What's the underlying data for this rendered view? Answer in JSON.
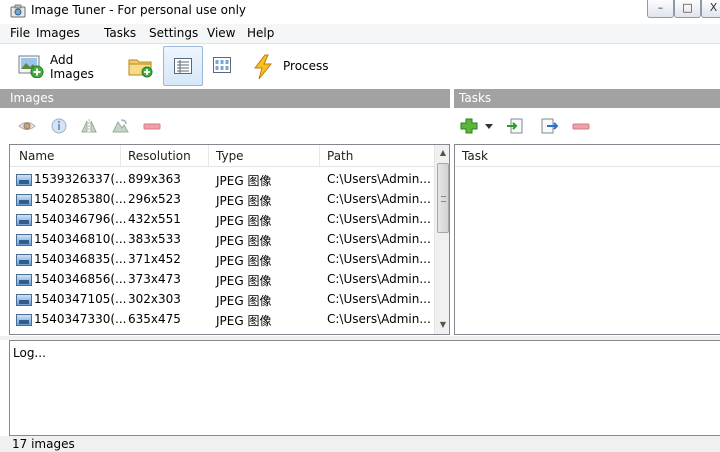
{
  "window": {
    "title": "Image Tuner - For personal use only",
    "icon": "app-camera-icon",
    "controls": {
      "minimize": "–",
      "maximize": "□",
      "close": "X"
    }
  },
  "menu": {
    "items": [
      "File",
      "Images",
      "Tasks",
      "Settings",
      "View",
      "Help"
    ]
  },
  "toolbar": {
    "add_images_line1": "Add",
    "add_images_line2": "Images",
    "add_folder_icon": "folder-add-icon",
    "details_view_icon": "details-view-icon",
    "thumbnails_view_icon": "thumbnails-view-icon",
    "process_label": "Process",
    "process_icon": "lightning-icon"
  },
  "images_panel": {
    "header": "Images",
    "tools": [
      "view-eye-icon",
      "info-icon",
      "mirror-icon",
      "rotate-icon",
      "remove-icon"
    ],
    "columns": [
      "Name",
      "Resolution",
      "Type",
      "Path"
    ],
    "rows": [
      {
        "name": "1539326337(...",
        "resolution": "899x363",
        "type": "JPEG 图像",
        "path": "C:\\Users\\Admin..."
      },
      {
        "name": "1540285380(...",
        "resolution": "296x523",
        "type": "JPEG 图像",
        "path": "C:\\Users\\Admin..."
      },
      {
        "name": "1540346796(...",
        "resolution": "432x551",
        "type": "JPEG 图像",
        "path": "C:\\Users\\Admin..."
      },
      {
        "name": "1540346810(...",
        "resolution": "383x533",
        "type": "JPEG 图像",
        "path": "C:\\Users\\Admin..."
      },
      {
        "name": "1540346835(...",
        "resolution": "371x452",
        "type": "JPEG 图像",
        "path": "C:\\Users\\Admin..."
      },
      {
        "name": "1540346856(...",
        "resolution": "373x473",
        "type": "JPEG 图像",
        "path": "C:\\Users\\Admin..."
      },
      {
        "name": "1540347105(...",
        "resolution": "302x303",
        "type": "JPEG 图像",
        "path": "C:\\Users\\Admin..."
      },
      {
        "name": "1540347330(...",
        "resolution": "635x475",
        "type": "JPEG 图像",
        "path": "C:\\Users\\Admin..."
      }
    ]
  },
  "tasks_panel": {
    "header": "Tasks",
    "tools": [
      "add-task-icon",
      "dropdown-arrow-icon",
      "import-task-icon",
      "export-task-icon",
      "remove-task-icon"
    ],
    "column": "Task"
  },
  "log": {
    "label": "Log..."
  },
  "status": {
    "text": "17 images"
  },
  "colors": {
    "panel_header": "#a2a2a2",
    "menubar": "#f5f6f8",
    "selected_view": "#d6e7f8"
  }
}
